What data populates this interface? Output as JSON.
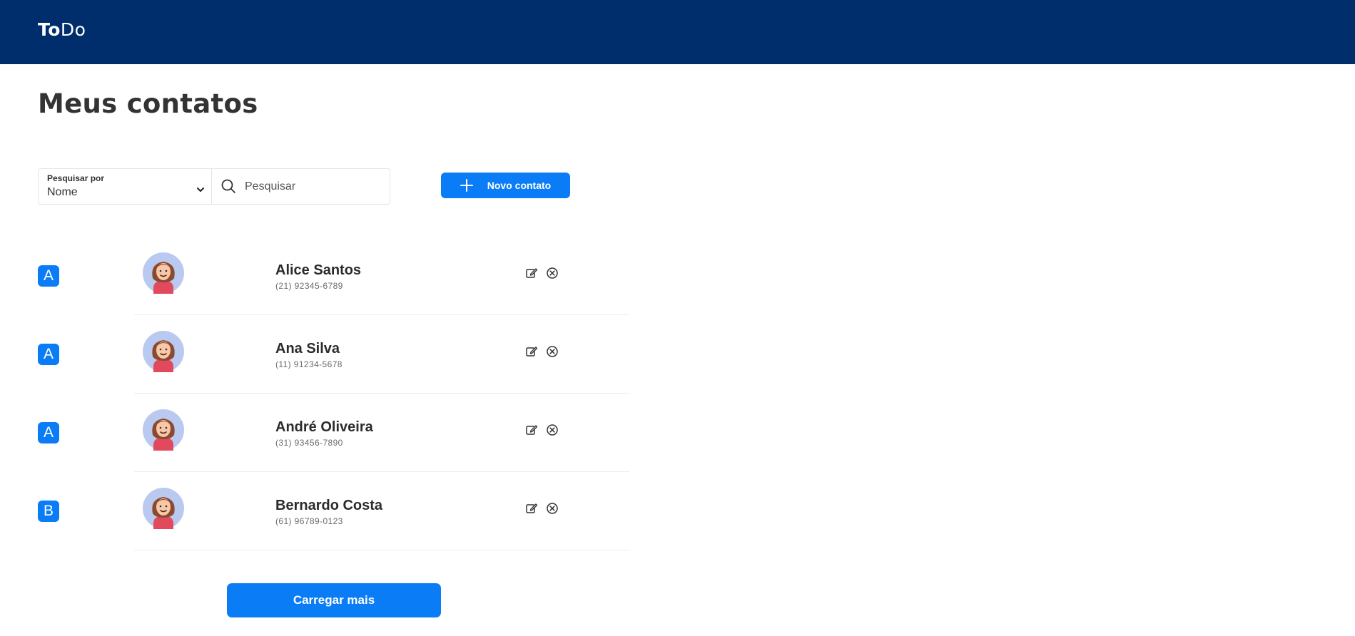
{
  "header": {
    "logo_bold": "To",
    "logo_light": "Do"
  },
  "page": {
    "title": "Meus contatos"
  },
  "search": {
    "by_label": "Pesquisar por",
    "by_value": "Nome",
    "placeholder": "Pesquisar"
  },
  "actions": {
    "new_contact": "Novo contato",
    "load_more": "Carregar mais"
  },
  "contacts": [
    {
      "letter": "A",
      "name": "Alice Santos",
      "phone": "(21) 92345-6789"
    },
    {
      "letter": "A",
      "name": "Ana Silva",
      "phone": "(11) 91234-5678"
    },
    {
      "letter": "A",
      "name": "André Oliveira",
      "phone": "(31) 93456-7890"
    },
    {
      "letter": "B",
      "name": "Bernardo Costa",
      "phone": "(61) 96789-0123"
    }
  ],
  "colors": {
    "header_bg": "#002d6b",
    "accent": "#0a7cf6"
  },
  "icons": [
    "chevron-down-icon",
    "search-icon",
    "plus-icon",
    "avatar-icon",
    "edit-icon",
    "delete-icon"
  ]
}
